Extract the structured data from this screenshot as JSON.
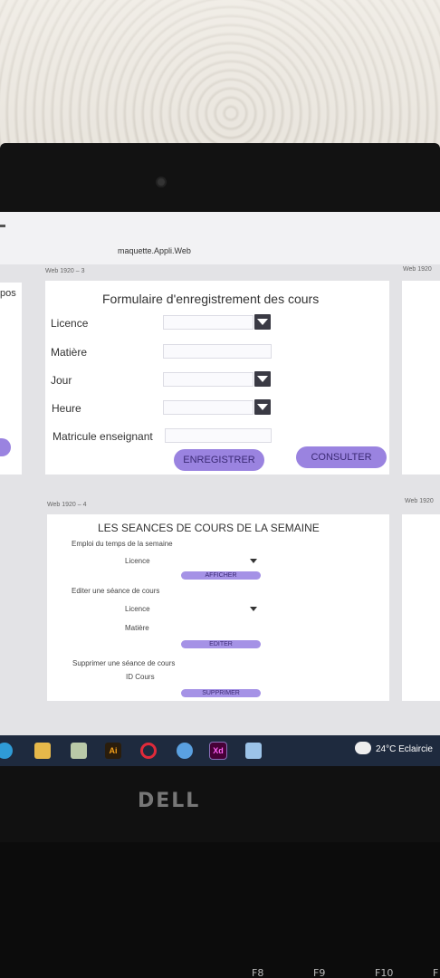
{
  "app": {
    "title": "maquette.Appli.Web"
  },
  "frames": {
    "f3": "Web 1920 – 3",
    "f3_right": "Web 1920",
    "f4": "Web 1920 – 4",
    "f4_right": "Web 1920",
    "left_partial": "pos"
  },
  "form": {
    "title": "Formulaire d'enregistrement des cours",
    "fields": [
      {
        "label": "Licence",
        "type": "dropdown",
        "value": ""
      },
      {
        "label": "Matière",
        "type": "text",
        "value": ""
      },
      {
        "label": "Jour",
        "type": "dropdown",
        "value": ""
      },
      {
        "label": "Heure",
        "type": "dropdown",
        "value": ""
      },
      {
        "label": "Matricule enseignant",
        "type": "text",
        "value": ""
      }
    ],
    "buttons": {
      "save": "ENREGISTRER",
      "consult": "CONSULTER"
    }
  },
  "sessions": {
    "title": "LES SEANCES DE COURS DE LA SEMAINE",
    "timetable_label": "Emploi du temps de la semaine",
    "licence": "Licence",
    "show_btn": "AFFICHER",
    "edit_label": "Editer une séance de cours",
    "licence2": "Licence",
    "matiere": "Matière",
    "edit_btn": "EDITER",
    "delete_label": "Supprimer une séance de cours",
    "course_id": "ID Cours",
    "delete_btn": "SUPPRIMER"
  },
  "taskbar": {
    "icons": [
      "edge-icon",
      "file-explorer-icon",
      "calendar-icon",
      "illustrator-icon",
      "opera-icon",
      "chrome-icon",
      "xd-icon",
      "network-icon"
    ],
    "illustrator_text": "Ai",
    "xd_text": "Xd",
    "weather": "24°C  Eclaircie"
  },
  "laptop": {
    "brand": "DELL",
    "keys": [
      "F8",
      "F9",
      "F10",
      "F"
    ]
  },
  "colors": {
    "accent": "#9a83e0",
    "taskbar": "#1e2a3e",
    "dropdown": "#3a3a44"
  }
}
